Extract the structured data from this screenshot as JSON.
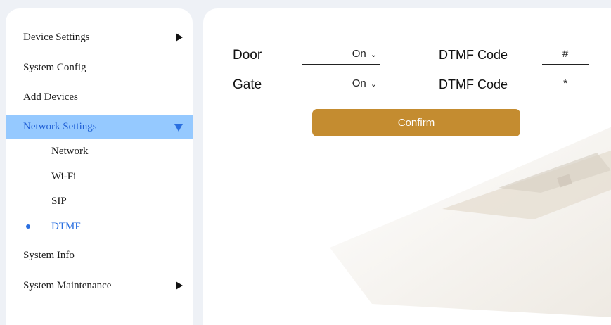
{
  "sidebar": {
    "items": [
      {
        "label": "Device Settings"
      },
      {
        "label": "System Config"
      },
      {
        "label": "Add Devices"
      },
      {
        "label": "Network Settings"
      },
      {
        "label": "System Info"
      },
      {
        "label": "System Maintenance"
      }
    ],
    "sub_items": [
      {
        "label": "Network"
      },
      {
        "label": "Wi-Fi"
      },
      {
        "label": "SIP"
      },
      {
        "label": "DTMF"
      }
    ]
  },
  "form": {
    "door": {
      "label": "Door",
      "value": "On",
      "code_label": "DTMF Code",
      "code_value": "#"
    },
    "gate": {
      "label": "Gate",
      "value": "On",
      "code_label": "DTMF Code",
      "code_value": "*"
    },
    "confirm_label": "Confirm"
  },
  "colors": {
    "accent": "#c48c30",
    "nav_active_bg": "#95c9ff",
    "nav_active_text": "#1f5fd6"
  },
  "icons": {
    "expand": "triangle-right-icon",
    "collapse": "triangle-down-icon",
    "dropdown": "chevron-down-icon",
    "active_bullet": "bullet-icon"
  }
}
